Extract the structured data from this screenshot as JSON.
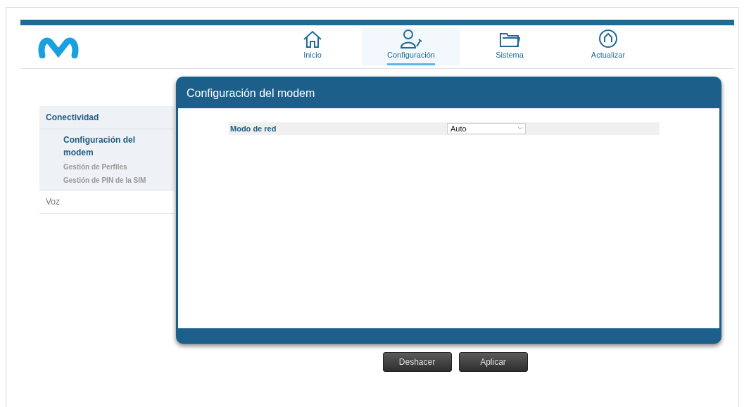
{
  "nav": [
    {
      "label": "Inicio",
      "selected": false
    },
    {
      "label": "Configuración",
      "selected": true
    },
    {
      "label": "Sistema",
      "selected": false
    },
    {
      "label": "Actualizar",
      "selected": false
    }
  ],
  "sidebar": {
    "items": [
      {
        "label": "Conectividad",
        "expanded": true,
        "children": [
          {
            "label": "Configuración del modem",
            "selected": true
          },
          {
            "label": "Gestión de Perfiles",
            "selected": false
          },
          {
            "label": "Gestión de PIN de la SIM",
            "selected": false
          }
        ]
      },
      {
        "label": "Voz",
        "expanded": false
      }
    ]
  },
  "panel": {
    "title": "Configuración del modem",
    "fields": [
      {
        "label": "Modo de red",
        "value": "Auto"
      }
    ]
  },
  "buttons": [
    "Deshacer",
    "Aplicar"
  ]
}
